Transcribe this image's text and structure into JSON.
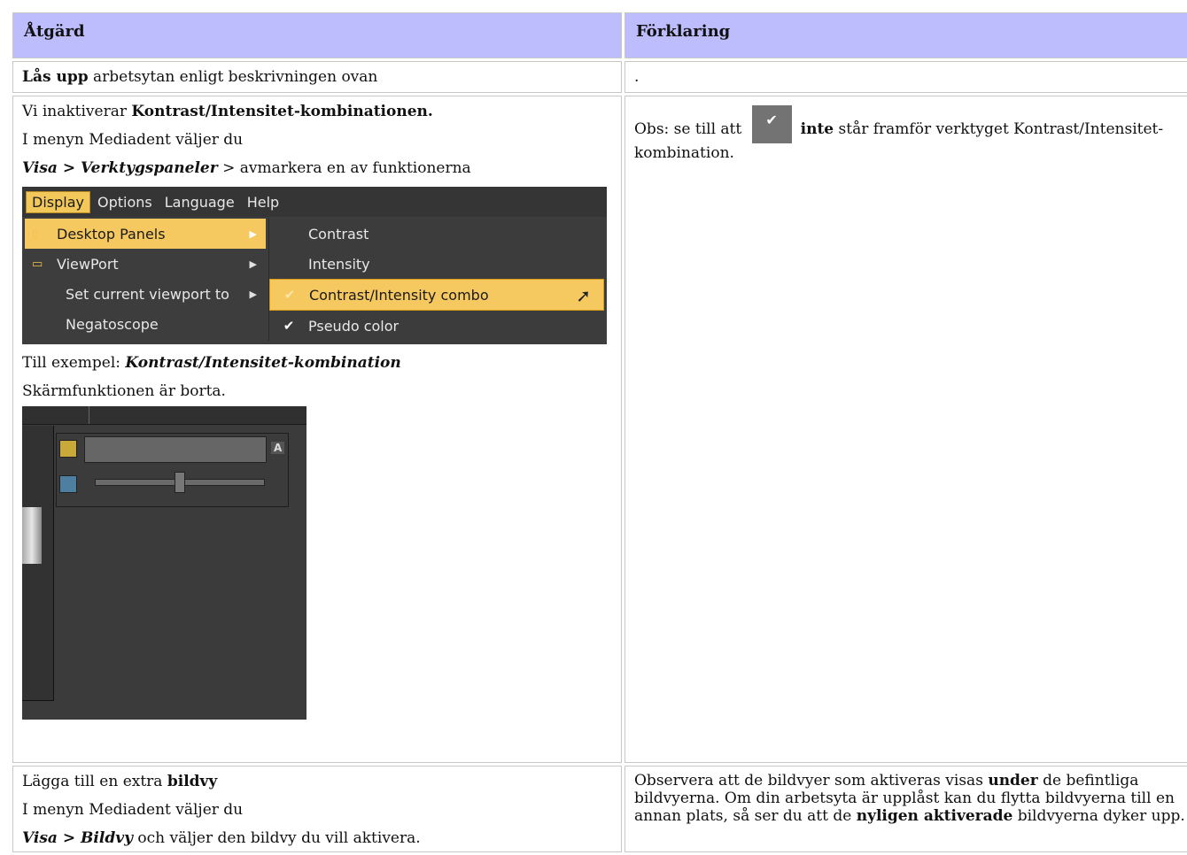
{
  "header": {
    "col1": "Åtgärd",
    "col2": "Förklaring"
  },
  "row1": {
    "action_bold": "Lås upp",
    "action_rest": " arbetsytan enligt beskrivningen ovan",
    "explanation": "."
  },
  "row2": {
    "p1_a": "Vi inaktiverar ",
    "p1_b": "Kontrast/Intensitet-kombinationen.",
    "p2": "I menyn Mediadent väljer du",
    "p3_a": "Visa",
    "p3_b": " > ",
    "p3_c": "Verktygspaneler",
    "p3_d": " > avmarkera en av funktionerna",
    "p4_a": "Till exempel: ",
    "p4_b": "Kontrast/Intensitet-kombination",
    "p5": "Skärmfunktionen är borta.",
    "explanation_a": "Obs: se till att ",
    "explanation_b": "inte",
    "explanation_c": " står framför verktyget Kontrast/Intensitet-kombination.",
    "check_icon": "check-icon",
    "menu": {
      "bar": [
        "Display",
        "Options",
        "Language",
        "Help"
      ],
      "left_items": [
        "Desktop Panels",
        "ViewPort",
        "Set current viewport to",
        "Negatoscope"
      ],
      "right_items": [
        "Contrast",
        "Intensity",
        "Contrast/Intensity combo",
        "Pseudo color"
      ]
    },
    "panel_a_label": "A"
  },
  "row3": {
    "p1_a": "Lägga till en extra ",
    "p1_b": "bildvy",
    "p2": "I menyn Mediadent väljer du",
    "p3_a": "Visa",
    "p3_b": " > ",
    "p3_c": "Bildvy",
    "p3_d": " och väljer den bildvy du vill aktivera.",
    "ex_a": "Observera att de bildvyer som aktiveras visas ",
    "ex_b": "under",
    "ex_c": " de befintliga bildvyerna. Om din arbetsyta är upplåst kan du flytta bildvyerna till en annan plats, så ser du att de ",
    "ex_d": "nyligen aktiverade",
    "ex_e": " bildvyerna dyker upp."
  }
}
